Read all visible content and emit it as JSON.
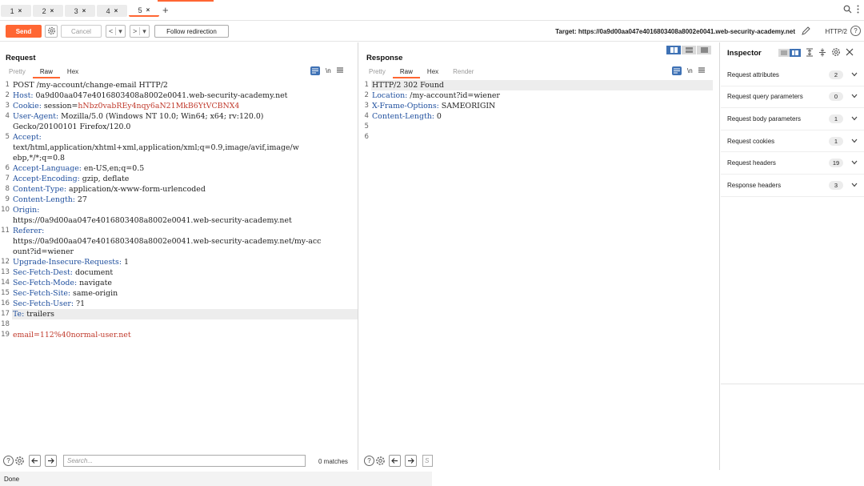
{
  "tabs": [
    {
      "label": "1",
      "close": "×"
    },
    {
      "label": "2",
      "close": "×"
    },
    {
      "label": "3",
      "close": "×"
    },
    {
      "label": "4",
      "close": "×"
    },
    {
      "label": "5",
      "close": "×"
    }
  ],
  "tab_add": "+",
  "toolbar": {
    "send_label": "Send",
    "cancel_label": "Cancel",
    "back_label": "<",
    "back_menu": "▾",
    "forward_label": ">",
    "forward_menu": "▾",
    "follow_label": "Follow redirection",
    "target_text": "Target: https://0a9d00aa047e4016803408a8002e0041.web-security-academy.net",
    "protocol": "HTTP/2",
    "help": "?"
  },
  "request": {
    "title": "Request",
    "tabs": [
      "Pretty",
      "Raw",
      "Hex"
    ],
    "active_tab": "Raw",
    "newline_toggle": "\\n",
    "lines": [
      {
        "n": "1",
        "k": "",
        "v": "POST /my-account/change-email HTTP/2"
      },
      {
        "n": "2",
        "k": "Host:",
        "v": " 0a9d00aa047e4016803408a8002e0041.web-security-academy.net"
      },
      {
        "n": "3",
        "k": "Cookie:",
        "v": " session=",
        "red": "hNbz0vabREy4nqy6aN21MkB6YtVCBNX4"
      },
      {
        "n": "4",
        "k": "User-Agent:",
        "v": " Mozilla/5.0 (Windows NT 10.0; Win64; x64; rv:120.0)"
      },
      {
        "n": "",
        "k": "",
        "v": "Gecko/20100101 Firefox/120.0"
      },
      {
        "n": "5",
        "k": "Accept:",
        "v": ""
      },
      {
        "n": "",
        "k": "",
        "v": "text/html,application/xhtml+xml,application/xml;q=0.9,image/avif,image/w"
      },
      {
        "n": "",
        "k": "",
        "v": "ebp,*/*;q=0.8"
      },
      {
        "n": "6",
        "k": "Accept-Language:",
        "v": " en-US,en;q=0.5"
      },
      {
        "n": "7",
        "k": "Accept-Encoding:",
        "v": " gzip, deflate"
      },
      {
        "n": "8",
        "k": "Content-Type:",
        "v": " application/x-www-form-urlencoded"
      },
      {
        "n": "9",
        "k": "Content-Length:",
        "v": " 27"
      },
      {
        "n": "10",
        "k": "Origin:",
        "v": ""
      },
      {
        "n": "",
        "k": "",
        "v": "https://0a9d00aa047e4016803408a8002e0041.web-security-academy.net"
      },
      {
        "n": "11",
        "k": "Referer:",
        "v": ""
      },
      {
        "n": "",
        "k": "",
        "v": "https://0a9d00aa047e4016803408a8002e0041.web-security-academy.net/my-acc"
      },
      {
        "n": "",
        "k": "",
        "v": "ount?id=wiener"
      },
      {
        "n": "12",
        "k": "Upgrade-Insecure-Requests:",
        "v": " 1"
      },
      {
        "n": "13",
        "k": "Sec-Fetch-Dest:",
        "v": " document"
      },
      {
        "n": "14",
        "k": "Sec-Fetch-Mode:",
        "v": " navigate"
      },
      {
        "n": "15",
        "k": "Sec-Fetch-Site:",
        "v": " same-origin"
      },
      {
        "n": "16",
        "k": "Sec-Fetch-User:",
        "v": " ?1"
      },
      {
        "n": "17",
        "k": "Te:",
        "v": " trailers",
        "hl": true
      },
      {
        "n": "18",
        "k": "",
        "v": ""
      },
      {
        "n": "19",
        "k": "",
        "v": "",
        "red": "email=112%40normal-user.net"
      }
    ],
    "search_placeholder": "Search...",
    "matches": "0 matches"
  },
  "response": {
    "title": "Response",
    "tabs": [
      "Pretty",
      "Raw",
      "Hex",
      "Render"
    ],
    "active_tab": "Raw",
    "newline_toggle": "\\n",
    "lines": [
      {
        "n": "1",
        "k": "",
        "v": "HTTP/2 302 Found",
        "hl": true
      },
      {
        "n": "2",
        "k": "Location:",
        "v": " /my-account?id=wiener"
      },
      {
        "n": "3",
        "k": "X-Frame-Options:",
        "v": " SAMEORIGIN"
      },
      {
        "n": "4",
        "k": "Content-Length:",
        "v": " 0"
      },
      {
        "n": "5",
        "k": "",
        "v": ""
      },
      {
        "n": "6",
        "k": "",
        "v": ""
      }
    ],
    "search_placeholder": "S"
  },
  "inspector": {
    "title": "Inspector",
    "rows": [
      {
        "label": "Request attributes",
        "count": "2"
      },
      {
        "label": "Request query parameters",
        "count": "0"
      },
      {
        "label": "Request body parameters",
        "count": "1"
      },
      {
        "label": "Request cookies",
        "count": "1"
      },
      {
        "label": "Request headers",
        "count": "19"
      },
      {
        "label": "Response headers",
        "count": "3"
      }
    ]
  },
  "status": {
    "text": "Done"
  },
  "colors": {
    "accent": "#ff6633",
    "blue": "#3f72b5",
    "header_key": "#1f4f9e",
    "value_red": "#c0392b"
  }
}
